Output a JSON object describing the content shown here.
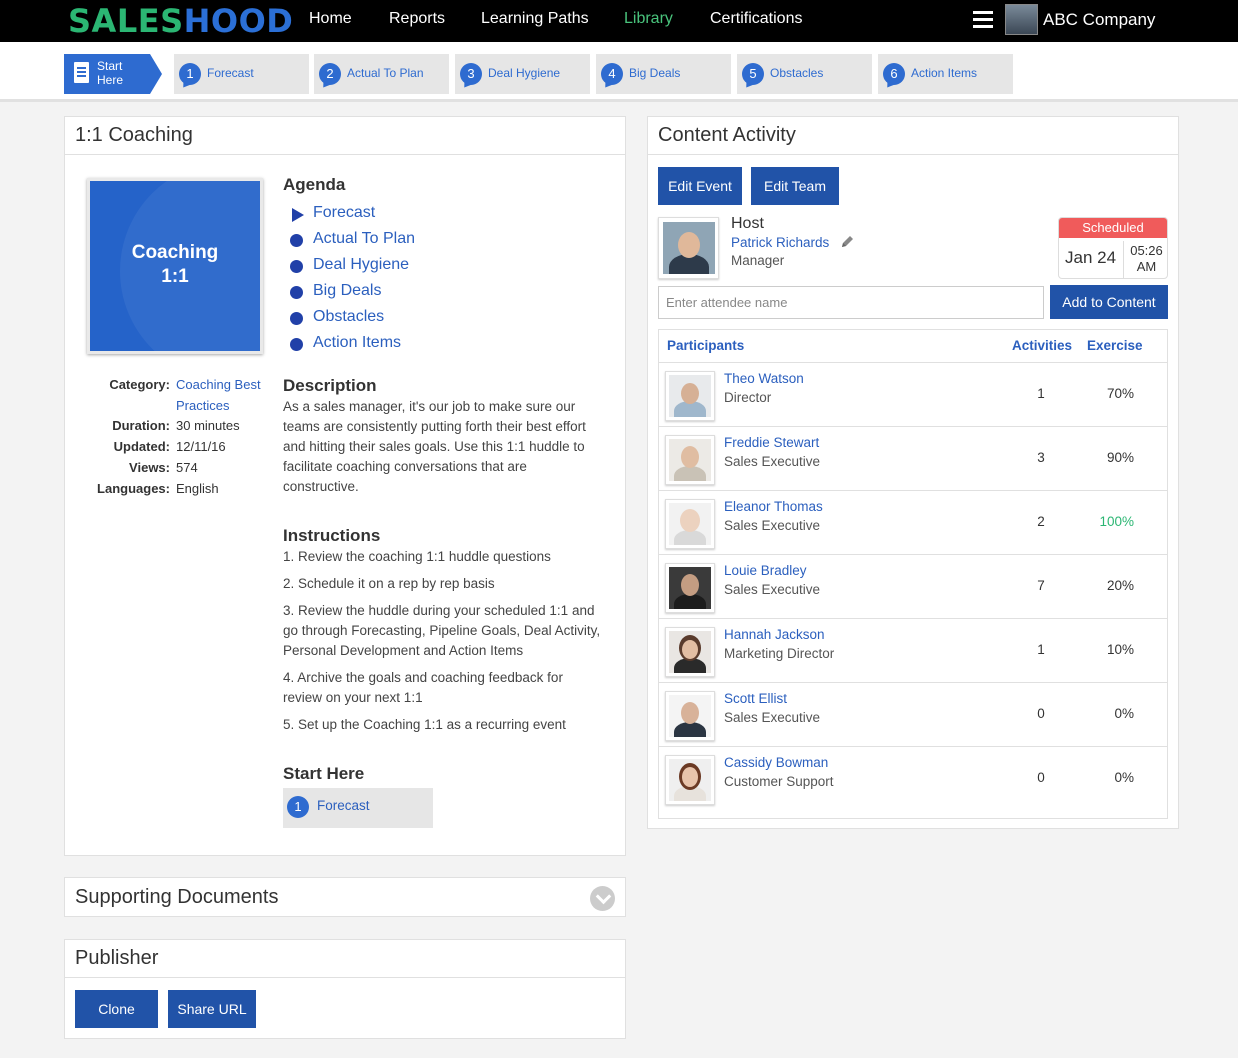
{
  "brand": {
    "part1": "SALES",
    "part2": "HOOD"
  },
  "nav": {
    "items": [
      {
        "label": "Home",
        "active": false
      },
      {
        "label": "Reports",
        "active": false
      },
      {
        "label": "Learning Paths",
        "active": false
      },
      {
        "label": "Library",
        "active": true
      },
      {
        "label": "Certifications",
        "active": false
      }
    ],
    "company": "ABC Company"
  },
  "steps": {
    "start_label": "Start Here",
    "items": [
      {
        "num": "1",
        "label": "Forecast"
      },
      {
        "num": "2",
        "label": "Actual To Plan"
      },
      {
        "num": "3",
        "label": "Deal Hygiene"
      },
      {
        "num": "4",
        "label": "Big Deals"
      },
      {
        "num": "5",
        "label": "Obstacles"
      },
      {
        "num": "6",
        "label": "Action Items"
      }
    ]
  },
  "coaching": {
    "title": "1:1 Coaching",
    "cover": {
      "line1": "Coaching",
      "line2": "1:1"
    },
    "meta": {
      "category_key": "Category:",
      "category_val": "Coaching Best Practices",
      "duration_key": "Duration:",
      "duration_val": "30 minutes",
      "updated_key": "Updated:",
      "updated_val": "12/11/16",
      "views_key": "Views:",
      "views_val": "574",
      "languages_key": "Languages:",
      "languages_val": "English"
    },
    "agenda_title": "Agenda",
    "agenda": [
      "Forecast",
      "Actual To Plan",
      "Deal Hygiene",
      "Big Deals",
      "Obstacles",
      "Action Items"
    ],
    "description_title": "Description",
    "description": "As a sales manager, it's our job to make sure our teams are consistently putting forth their best effort and hitting their sales goals. Use this 1:1 huddle to facilitate coaching conversations that are constructive.",
    "instructions_title": "Instructions",
    "instructions": [
      "1. Review the coaching 1:1 huddle questions",
      "2. Schedule it on a rep by rep basis",
      "3. Review the huddle during your scheduled 1:1 and go through Forecasting, Pipeline Goals, Deal Activity, Personal Development and Action Items",
      "4. Archive the goals and coaching feedback for review on your next 1:1",
      "5. Set up the Coaching 1:1 as a recurring event"
    ],
    "start_title": "Start Here",
    "start_step": {
      "num": "1",
      "label": "Forecast"
    }
  },
  "supporting": {
    "title": "Supporting Documents"
  },
  "publisher": {
    "title": "Publisher",
    "clone": "Clone",
    "share": "Share URL"
  },
  "activity": {
    "title": "Content Activity",
    "edit_event": "Edit Event",
    "edit_team": "Edit Team",
    "host_label": "Host",
    "host_name": "Patrick Richards",
    "host_role": "Manager",
    "status": "Scheduled",
    "date": "Jan 24",
    "time_line1": "05:26",
    "time_line2": "AM",
    "attendee_placeholder": "Enter attendee name",
    "add_button": "Add to Content",
    "columns": {
      "participants": "Participants",
      "activities": "Activities",
      "exercise": "Exercise"
    },
    "participants": [
      {
        "name": "Theo Watson",
        "role": "Director",
        "activities": "1",
        "exercise": "70%"
      },
      {
        "name": "Freddie Stewart",
        "role": "Sales Executive",
        "activities": "3",
        "exercise": "90%"
      },
      {
        "name": "Eleanor Thomas",
        "role": "Sales Executive",
        "activities": "2",
        "exercise": "100%"
      },
      {
        "name": "Louie Bradley",
        "role": "Sales Executive",
        "activities": "7",
        "exercise": "20%"
      },
      {
        "name": "Hannah Jackson",
        "role": "Marketing Director",
        "activities": "1",
        "exercise": "10%"
      },
      {
        "name": "Scott Ellist",
        "role": "Sales Executive",
        "activities": "0",
        "exercise": "0%"
      },
      {
        "name": "Cassidy Bowman",
        "role": "Customer Support",
        "activities": "0",
        "exercise": "0%"
      }
    ]
  },
  "colors": {
    "accent": "#2e6bd0",
    "button": "#2153a8",
    "brand_green": "#2bb673",
    "scheduled": "#f05b5b"
  }
}
